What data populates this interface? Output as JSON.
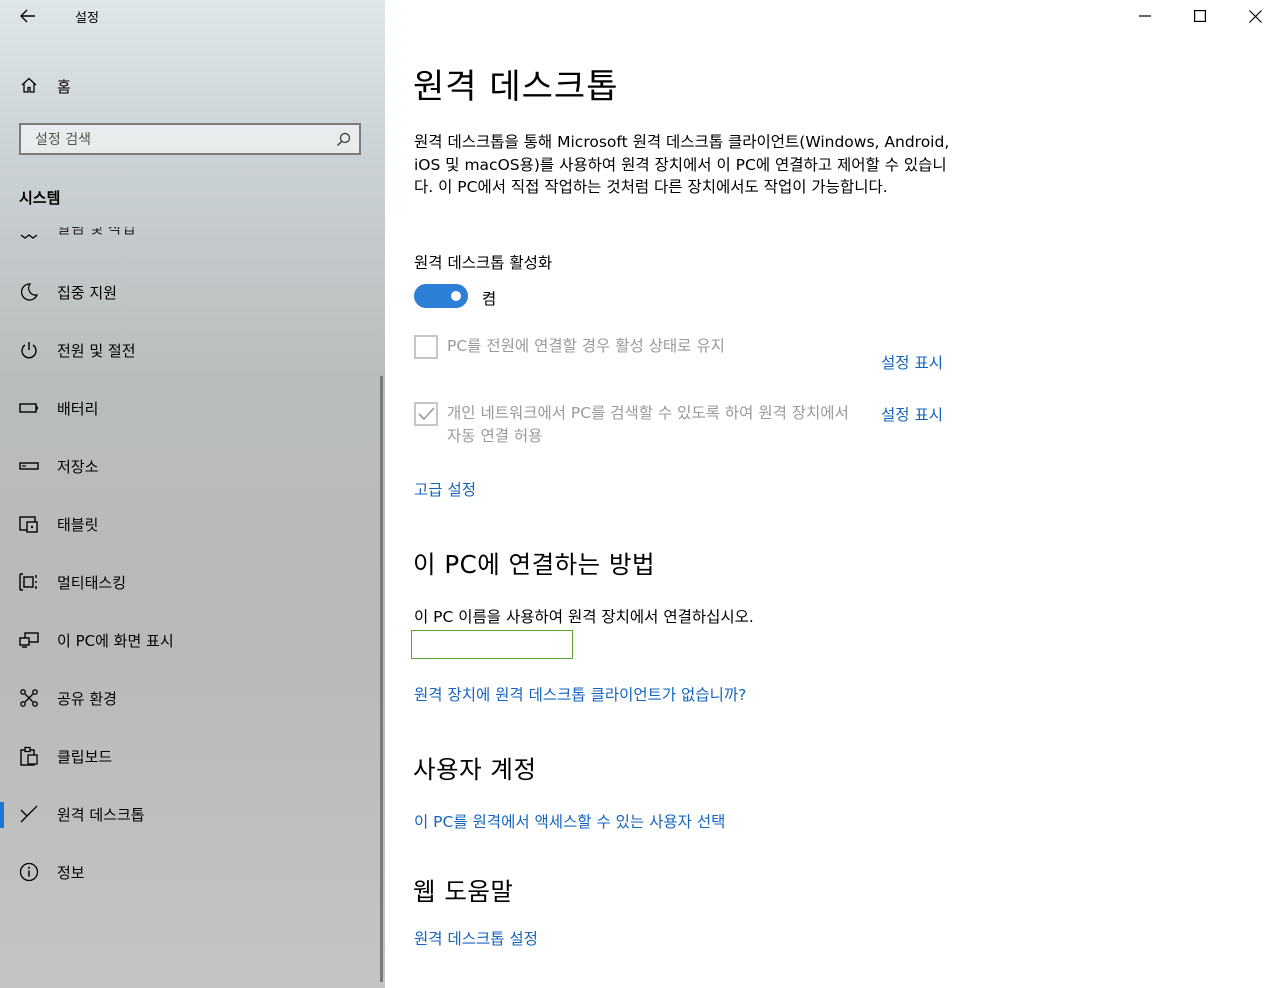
{
  "app": {
    "title": "설정"
  },
  "sidebar": {
    "home_label": "홈",
    "search_placeholder": "설정 검색",
    "section_title": "시스템",
    "clipped_item_label": "알림 및 작업",
    "items": [
      {
        "label": "집중 지원",
        "icon": "moon-icon"
      },
      {
        "label": "전원 및 절전",
        "icon": "power-icon"
      },
      {
        "label": "배터리",
        "icon": "battery-icon"
      },
      {
        "label": "저장소",
        "icon": "storage-icon"
      },
      {
        "label": "태블릿",
        "icon": "tablet-icon"
      },
      {
        "label": "멀티태스킹",
        "icon": "multitasking-icon"
      },
      {
        "label": "이 PC에 화면 표시",
        "icon": "project-icon"
      },
      {
        "label": "공유 환경",
        "icon": "share-icon"
      },
      {
        "label": "클립보드",
        "icon": "clipboard-icon"
      },
      {
        "label": "원격 데스크톱",
        "icon": "remote-desktop-icon",
        "selected": true
      },
      {
        "label": "정보",
        "icon": "info-icon"
      }
    ]
  },
  "main": {
    "title": "원격 데스크톱",
    "description": "원격 데스크톱을 통해 Microsoft 원격 데스크톱 클라이언트(Windows, Android, iOS 및 macOS용)를 사용하여 원격 장치에서 이 PC에 연결하고 제어할 수 있습니다. 이 PC에서 직접 작업하는 것처럼 다른 장치에서도 작업이 가능합니다.",
    "enable_label": "원격 데스크톱 활성화",
    "toggle_state": "켬",
    "toggle_on": true,
    "checkbox1": {
      "label": "PC를 전원에 연결할 경우 활성 상태로 유지",
      "checked": false,
      "link": "설정 표시"
    },
    "checkbox2": {
      "label": "개인 네트워크에서 PC를 검색할 수 있도록 하여 원격 장치에서 자동 연결 허용",
      "checked": true,
      "link": "설정 표시"
    },
    "advanced_link": "고급 설정",
    "connect_heading": "이 PC에 연결하는 방법",
    "connect_text": "이 PC 이름을 사용하여 원격 장치에서 연결하십시오.",
    "pc_name": "",
    "no_client_link": "원격 장치에 원격 데스크톱 클라이언트가 없습니까?",
    "user_heading": "사용자 계정",
    "user_link": "이 PC를 원격에서 액세스할 수 있는 사용자 선택",
    "web_heading": "웹 도움말",
    "web_link": "원격 데스크톱 설정"
  },
  "colors": {
    "accent": "#2d7ed6",
    "link": "#1565c0",
    "selection": "#1976d2"
  }
}
